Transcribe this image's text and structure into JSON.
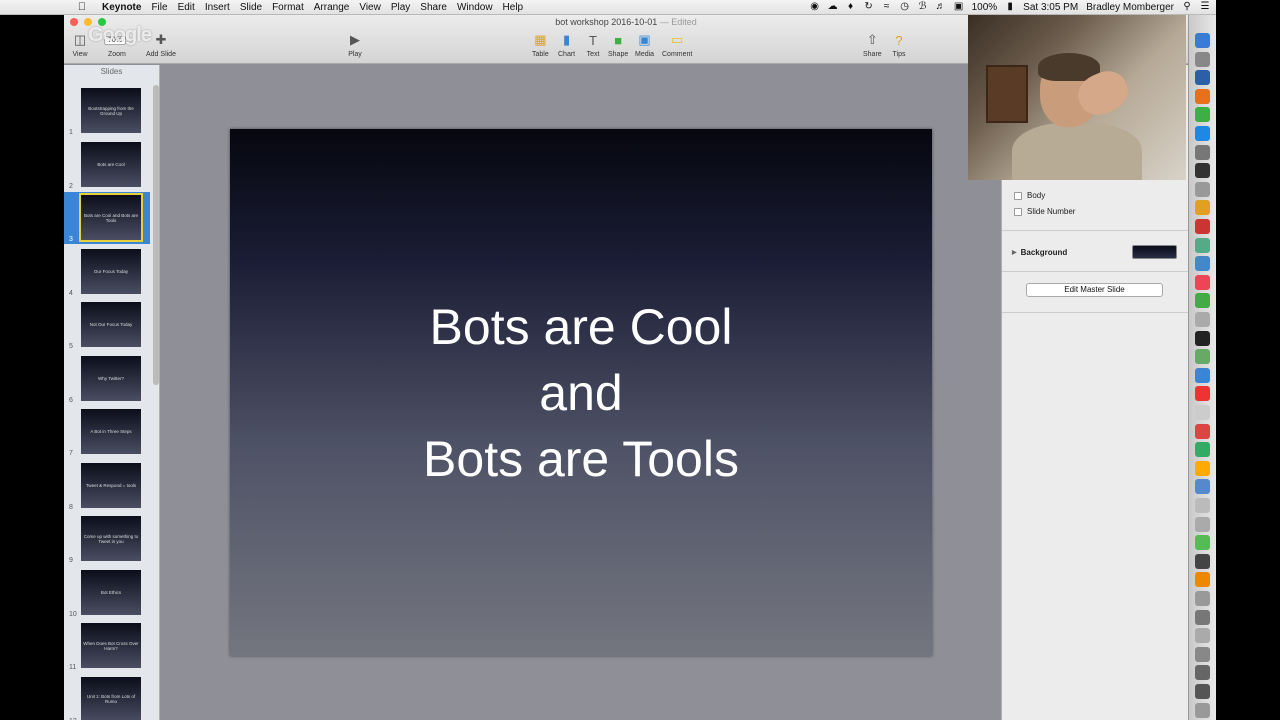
{
  "menubar": {
    "app_name": "Keynote",
    "items": [
      "File",
      "Edit",
      "Insert",
      "Slide",
      "Format",
      "Arrange",
      "View",
      "Play",
      "Share",
      "Window",
      "Help"
    ],
    "battery": "100%",
    "clock": "Sat 3:05 PM",
    "user": "Bradley Momberger"
  },
  "window": {
    "doc_title": "bot workshop 2016-10-01",
    "edited_label": "— Edited",
    "watermark": "Google",
    "zoom_value": "70%",
    "toolbar": {
      "view": "View",
      "zoom": "Zoom",
      "add_slide": "Add Slide",
      "play": "Play",
      "table": "Table",
      "chart": "Chart",
      "text": "Text",
      "shape": "Shape",
      "media": "Media",
      "comment": "Comment",
      "share": "Share",
      "tips": "Tips"
    }
  },
  "navigator": {
    "label": "Slides",
    "slides": [
      {
        "num": "1",
        "title": "Bootstrapping from the Ground Up"
      },
      {
        "num": "2",
        "title": "Bots are Cool"
      },
      {
        "num": "3",
        "title": "Bots are Cool and Bots are Tools"
      },
      {
        "num": "4",
        "title": "Our Focus Today"
      },
      {
        "num": "5",
        "title": "Not Our Focus Today"
      },
      {
        "num": "6",
        "title": "Why Twitter?"
      },
      {
        "num": "7",
        "title": "A Bot in Three Steps"
      },
      {
        "num": "8",
        "title": "Tweet & Respond = tools"
      },
      {
        "num": "9",
        "title": "Come up with something to Tweet in you"
      },
      {
        "num": "10",
        "title": "Bot Ethics"
      },
      {
        "num": "11",
        "title": "When Does Bot Cross Over Harm?"
      },
      {
        "num": "12",
        "title": "Unit 1: Bots from Lots of Rumo"
      }
    ],
    "selected_index": 2
  },
  "slide": {
    "line1": "Bots are Cool",
    "line2": "and",
    "line3": "Bots are Tools"
  },
  "inspector": {
    "body_label": "Body",
    "slide_number_label": "Slide Number",
    "background_label": "Background",
    "edit_master_button": "Edit Master Slide",
    "background_color": "#1a1d35"
  }
}
